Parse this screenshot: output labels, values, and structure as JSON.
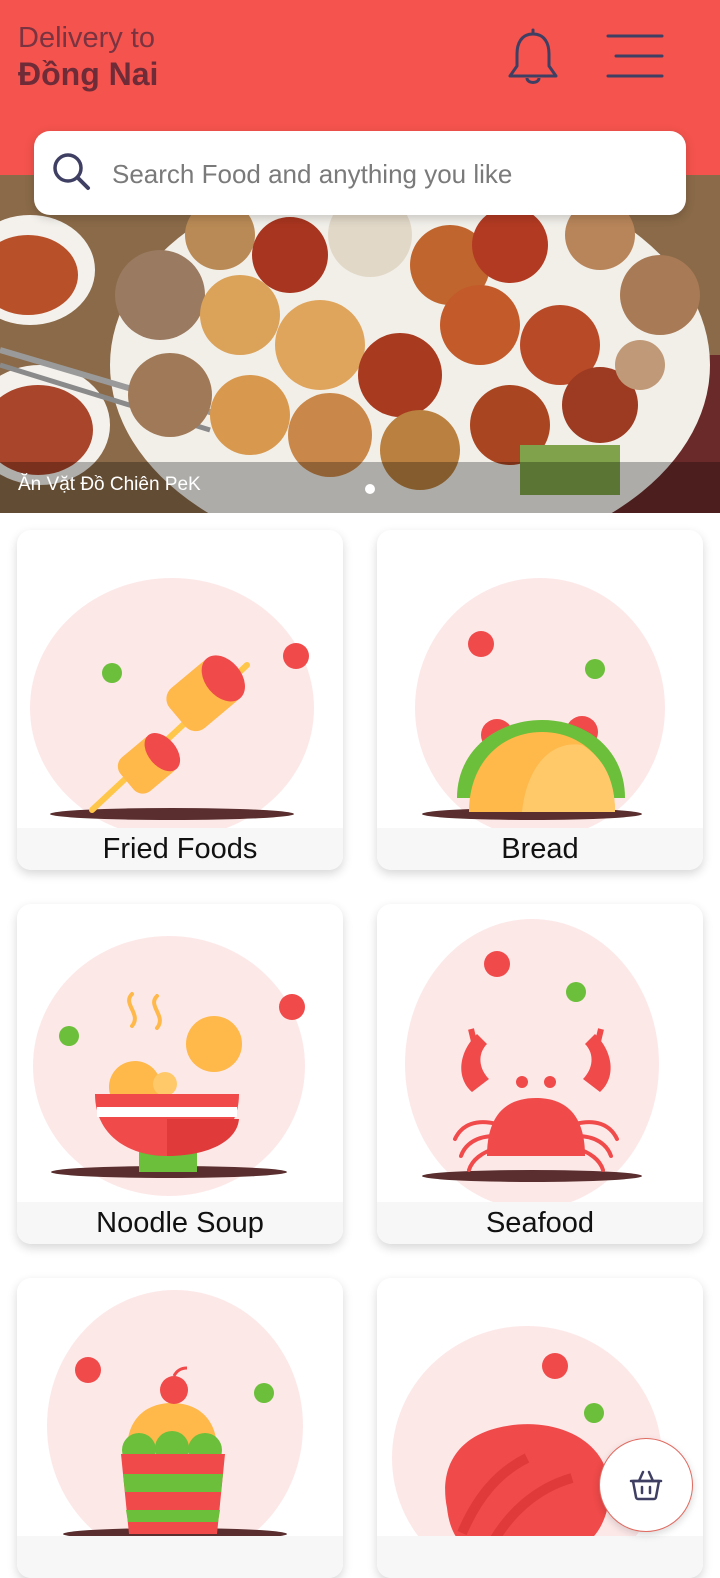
{
  "header": {
    "delivery_label": "Delivery to",
    "location": "Đồng Nai",
    "bell_icon": "bell-icon",
    "menu_icon": "hamburger-menu-icon"
  },
  "search": {
    "placeholder": "Search Food and anything you like",
    "icon": "search-icon"
  },
  "banner": {
    "caption": "Ăn Vặt Đồ Chiên PeK",
    "active_slide": 1
  },
  "categories": [
    {
      "label": "Fried Foods",
      "icon": "skewer-icon"
    },
    {
      "label": "Bread",
      "icon": "taco-icon"
    },
    {
      "label": "Noodle Soup",
      "icon": "noodle-bowl-icon"
    },
    {
      "label": "Seafood",
      "icon": "crab-icon"
    },
    {
      "label": "",
      "icon": "cupcake-icon"
    },
    {
      "label": "",
      "icon": "meat-icon"
    }
  ],
  "cart": {
    "icon": "basket-icon"
  },
  "colors": {
    "brand": "#f5534d",
    "text_dark": "#6e2b38",
    "illustration_bg": "#fde8e8"
  }
}
